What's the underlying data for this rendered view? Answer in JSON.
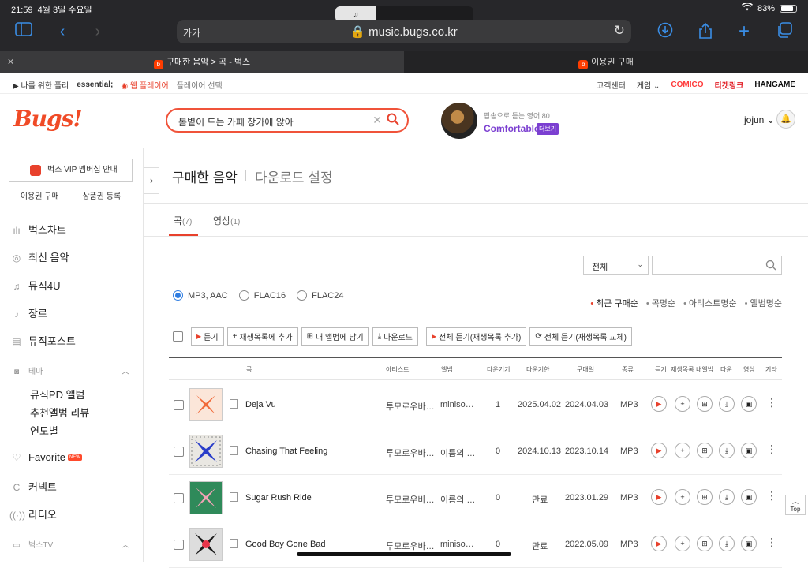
{
  "status": {
    "time": "21:59",
    "date": "4월 3일 수요일",
    "battery": "83%",
    "wifi_icon": "wifi-icon"
  },
  "pill": {
    "left": "♫"
  },
  "toolbar": {
    "aa": "가가",
    "url": "music.bugs.co.kr"
  },
  "tabs": [
    {
      "label": "구매한 음악 > 곡 - 벅스",
      "active": true
    },
    {
      "label": "이용권 구매",
      "active": false
    }
  ],
  "gnb": {
    "playlist": "나를 위한 플리",
    "essential": "essential;",
    "webplayer": "웹 플레이어",
    "player_select": "플레이어 선택",
    "support": "고객센터",
    "game": "게임",
    "comico": "COMICO",
    "ticket": "티켓링크",
    "hangame": "HANGAME"
  },
  "header": {
    "logo": "Bugs!",
    "search_query": "봄볕이 드는 카페 창가에 앉아",
    "promo_sub": "팝송으로 듣는 영어 80",
    "promo_title": "Comfortable",
    "promo_more": "더보기",
    "user": "jojun"
  },
  "sidebar": {
    "vip": "벅스 VIP 멤버십 안내",
    "buy": "이용권 구매",
    "coupon": "상품권 등록",
    "items": [
      {
        "label": "벅스차트",
        "icon": "chart-icon"
      },
      {
        "label": "최신 음악",
        "icon": "new-music-icon"
      },
      {
        "label": "뮤직4U",
        "icon": "note-icon"
      },
      {
        "label": "장르",
        "icon": "guitar-icon"
      },
      {
        "label": "뮤직포스트",
        "icon": "post-icon"
      }
    ],
    "theme": "테마",
    "theme_items": [
      "뮤직PD 앨범",
      "추천앨범 리뷰",
      "연도별"
    ],
    "favorite": "Favorite",
    "new_badge": "NEW",
    "connect": "커넥트",
    "radio": "라디오",
    "bugstv": "벅스TV"
  },
  "main": {
    "title": "구매한 음악",
    "subtitle": "다운로드 설정",
    "tab_songs": "곡",
    "tab_songs_count": "(7)",
    "tab_videos": "영상",
    "tab_videos_count": "(1)",
    "filter_select": "전체",
    "formats": [
      "MP3, AAC",
      "FLAC16",
      "FLAC24"
    ],
    "sorts": [
      "최근 구매순",
      "곡명순",
      "아티스트명순",
      "앨범명순"
    ],
    "actions": {
      "listen": "듣기",
      "add_playlist": "재생목록에 추가",
      "my_album": "내 앨범에 담기",
      "download": "다운로드",
      "listen_all_add": "전체 듣기(재생목록 추가)",
      "listen_all_replace": "전체 듣기(재생목록 교체)"
    },
    "columns": {
      "song": "곡",
      "artist": "아티스트",
      "album": "앨범",
      "downloads": "다운기기",
      "expiry": "다운기한",
      "purchased": "구매일",
      "type": "종류",
      "listen": "듣기",
      "playlist": "재생목록",
      "myalbum": "내앨범",
      "download": "다운",
      "video": "영상",
      "etc": "기타"
    },
    "rows": [
      {
        "title": "Deja Vu",
        "artist": "투모로우바…",
        "album": "miniso…",
        "count": "1",
        "expiry": "2025.04.02",
        "purchased": "2024.04.03",
        "type": "MP3"
      },
      {
        "title": "Chasing That Feeling",
        "artist": "투모로우바…",
        "album": "이름의 …",
        "count": "0",
        "expiry": "2024.10.13",
        "purchased": "2023.10.14",
        "type": "MP3"
      },
      {
        "title": "Sugar Rush Ride",
        "artist": "투모로우바…",
        "album": "이름의 …",
        "count": "0",
        "expiry": "만료",
        "purchased": "2023.01.29",
        "type": "MP3"
      },
      {
        "title": "Good Boy Gone Bad",
        "artist": "투모로우바…",
        "album": "miniso…",
        "count": "0",
        "expiry": "만료",
        "purchased": "2022.05.09",
        "type": "MP3"
      }
    ],
    "top": "Top"
  },
  "colors": {
    "accent": "#e8412c",
    "promo": "#7b3fd1",
    "safari_blue": "#3a8ee6"
  }
}
